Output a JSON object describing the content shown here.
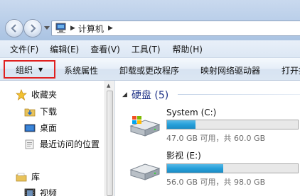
{
  "address": {
    "location": "计算机"
  },
  "menu": {
    "items": [
      "文件(F)",
      "编辑(E)",
      "查看(V)",
      "工具(T)",
      "帮助(H)"
    ]
  },
  "toolbar": {
    "organize": "组织",
    "system_properties": "系统属性",
    "uninstall": "卸载或更改程序",
    "map_drive": "映射网络驱动器",
    "open_panel": "打开控"
  },
  "nav": {
    "favorites": "收藏夹",
    "downloads": "下载",
    "desktop": "桌面",
    "recent": "最近访问的位置",
    "libraries": "库",
    "videos": "视频"
  },
  "content": {
    "group_title": "硬盘 (5)",
    "drives": [
      {
        "name": "System (C:)",
        "free_text": "47.0 GB 可用，共 60.0 GB",
        "used_fraction": 0.217
      },
      {
        "name": "影视 (E:)",
        "free_text": "56.0 GB 可用，共 98.0 GB",
        "used_fraction": 0.429
      }
    ]
  },
  "colors": {
    "accent": "#26a0da",
    "highlight_border": "#e02020",
    "group_title": "#1e3287"
  }
}
